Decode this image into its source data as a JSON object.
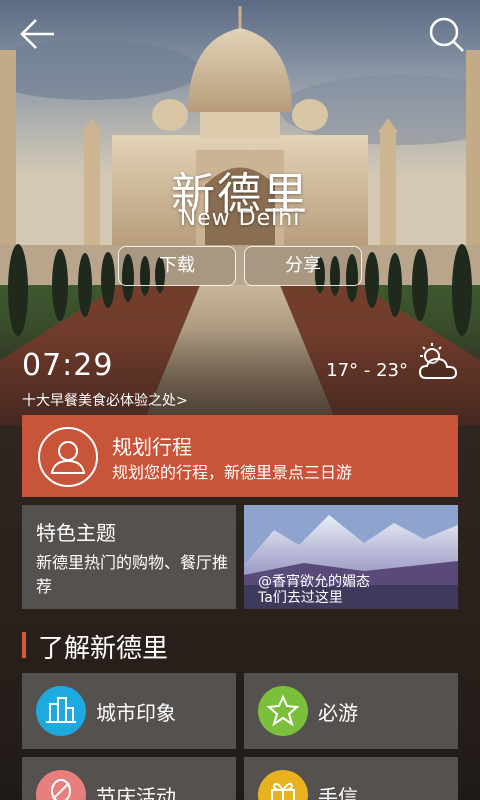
{
  "header": {
    "back_icon": "back-arrow-icon",
    "search_icon": "search-icon"
  },
  "hero": {
    "city_cn": "新德里",
    "city_en": "New Delhi",
    "download_label": "下载",
    "share_label": "分享"
  },
  "info": {
    "time": "07:29",
    "temperature": "17° - 23°",
    "weather_icon": "partly-cloudy-icon",
    "tagline": "十大早餐美食必体验之处>"
  },
  "plan_card": {
    "title": "规划行程",
    "subtitle": "规划您的行程，新德里景点三日游",
    "icon": "user-profile-icon",
    "color": "#c8553a"
  },
  "theme_card": {
    "title": "特色主题",
    "subtitle": "新德里热门的购物、餐厅推荐"
  },
  "photo_card": {
    "user": "@香宵欲允的媚态",
    "caption": "Ta们去过这里"
  },
  "section": {
    "title": "了解新德里",
    "accent": "#d3593c"
  },
  "tiles": [
    {
      "label": "城市印象",
      "icon": "city-buildings-icon",
      "color": "#1fa9e1"
    },
    {
      "label": "必游",
      "icon": "star-badge-icon",
      "color": "#7bbf3b"
    },
    {
      "label": "节庆活动",
      "icon": "balloon-icon",
      "color": "#e87f7f"
    },
    {
      "label": "手信",
      "icon": "gift-icon",
      "color": "#e8b21f"
    }
  ]
}
